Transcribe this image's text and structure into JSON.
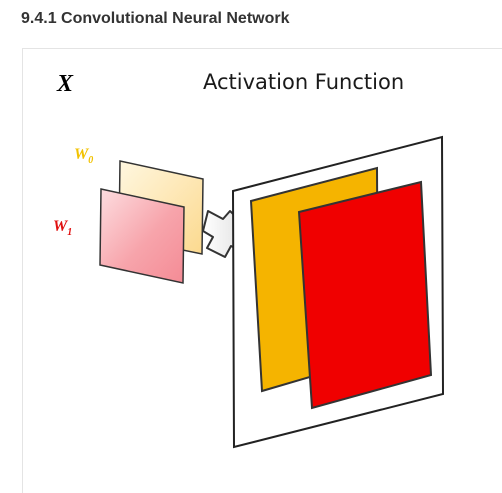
{
  "header": {
    "section_title": "9.4.1 Convolutional Neural Network"
  },
  "slide": {
    "input_symbol": "X",
    "title": "Activation Function",
    "weights": [
      {
        "base": "W",
        "subscript": "0",
        "color": "#f2c200",
        "fill_color": "#fde7b2"
      },
      {
        "base": "W",
        "subscript": "1",
        "color": "#e01010",
        "fill_color": "#f6a0a6"
      }
    ],
    "feature_maps": [
      {
        "color": "#f5b400"
      },
      {
        "color": "#f00000"
      }
    ],
    "frame_color": "#222222",
    "arrow_icon": "block-arrow-right"
  }
}
